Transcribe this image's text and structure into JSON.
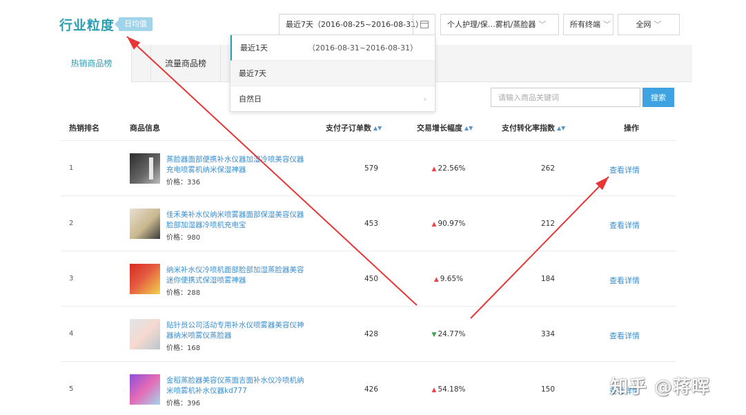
{
  "header": {
    "title": "行业粒度",
    "tag": "日均值"
  },
  "filters": {
    "date_range": "最近7天（2016-08-25~2016-08-31）",
    "category": "个人护理/保…雾机/蒸脸器",
    "terminal": "所有终端",
    "network": "全网"
  },
  "date_dropdown": {
    "items": [
      {
        "label": "最近1天",
        "range": "（2016-08-31~2016-08-31）"
      },
      {
        "label": "最近7天",
        "range": ""
      },
      {
        "label": "自然日",
        "range": ""
      }
    ]
  },
  "tabs": [
    "热销商品榜",
    "流量商品榜"
  ],
  "search": {
    "placeholder": "请输入商品关键词",
    "button": "搜索"
  },
  "table": {
    "columns": [
      "热销排名",
      "商品信息",
      "支付子订单数",
      "交易增长幅度",
      "支付转化率指数",
      "操作"
    ],
    "price_label": "价格：",
    "rows": [
      {
        "rank": "1",
        "name": "蒸脸器面部便携补水仪器加湿冷喷美容仪器充电喷雾机纳米保湿神器",
        "price": "336",
        "orders": "579",
        "growth": "22.56%",
        "trend": "up",
        "conversion": "262",
        "action": "查看详情"
      },
      {
        "rank": "2",
        "name": "佳禾美补水仪纳米喷雾器面部保湿美容仪器脸部加湿器冷喷机充电宝",
        "price": "980",
        "orders": "453",
        "growth": "90.97%",
        "trend": "up",
        "conversion": "212",
        "action": "查看详情"
      },
      {
        "rank": "3",
        "name": "纳米补水仪冷喷机面部脸部加湿蒸脸器美容迷你便携式保湿喷雾神器",
        "price": "288",
        "orders": "450",
        "growth": "9.65%",
        "trend": "up",
        "conversion": "184",
        "action": "查看详情"
      },
      {
        "rank": "4",
        "name": "贴针员公司活动专用补水仪喷雾器美容仪神器纳米喷雾仪蒸脸器",
        "price": "168",
        "orders": "428",
        "growth": "24.77%",
        "trend": "down",
        "conversion": "334",
        "action": "查看详情"
      },
      {
        "rank": "5",
        "name": "金稻蒸脸器美容仪蒸面吉面补水仪冷喷机纳米喷雾机补水仪器kd777",
        "price": "396",
        "orders": "426",
        "growth": "54.18%",
        "trend": "up",
        "conversion": "150",
        "action": "查看详情"
      }
    ]
  },
  "watermark": "知乎 @蒋晖",
  "annotation_color": "#e83535"
}
